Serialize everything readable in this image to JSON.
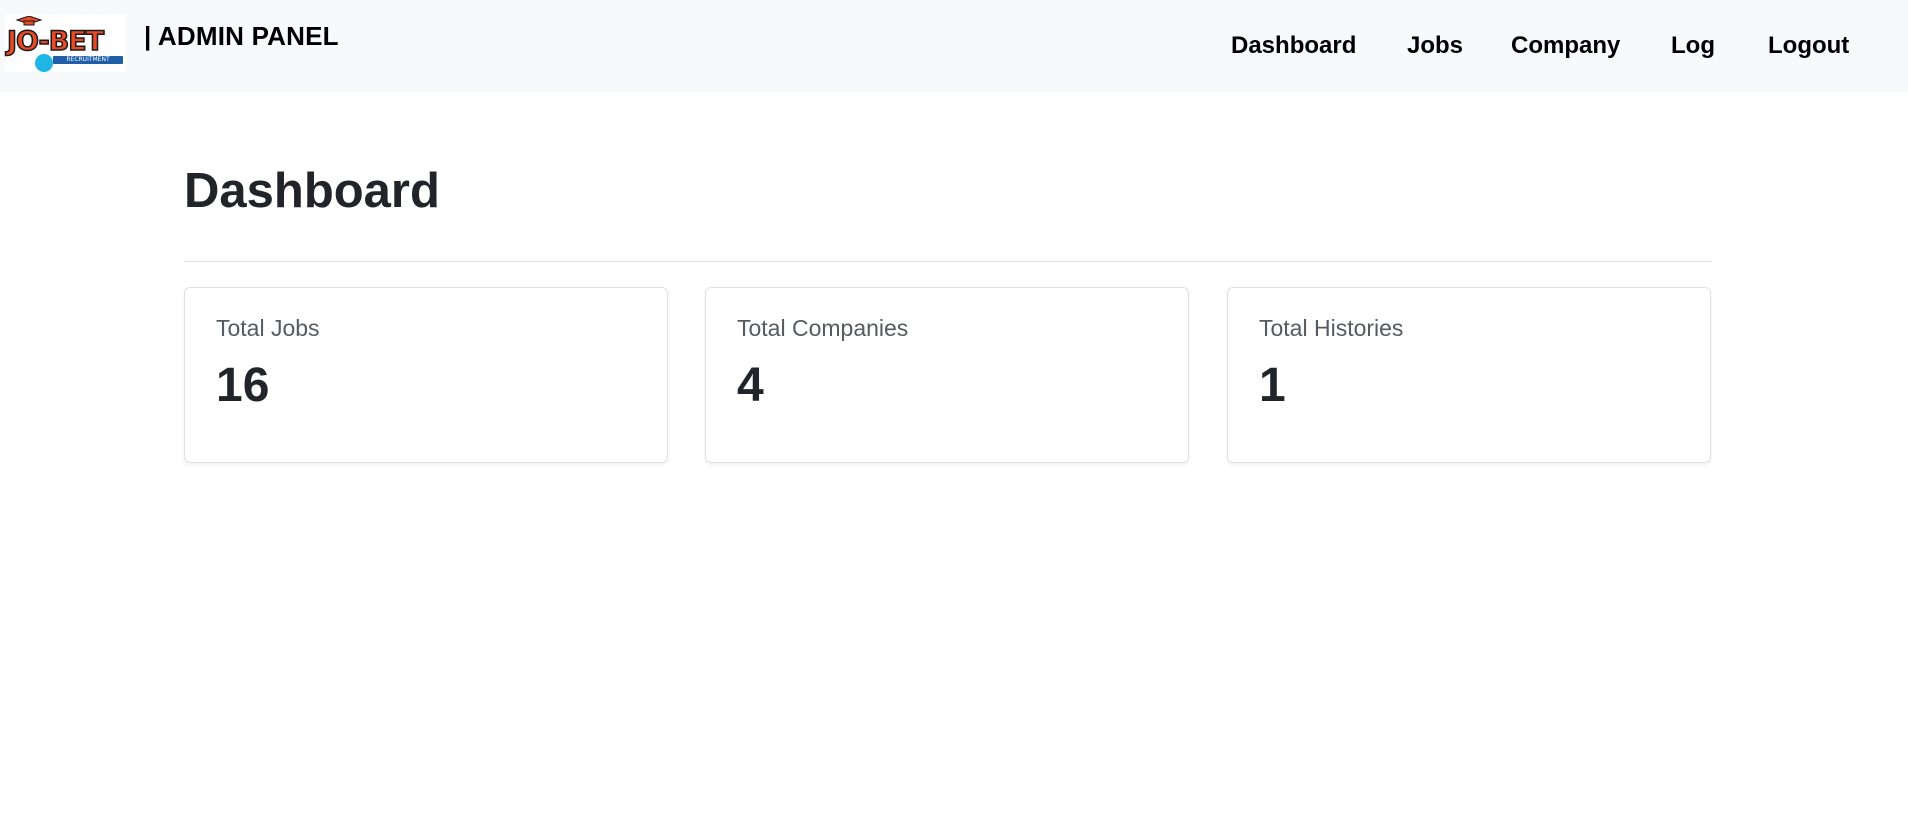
{
  "brand": {
    "logo_text": "JO-BET",
    "logo_tagline": "RECRUITMENT",
    "title": "| ADMIN PANEL"
  },
  "nav": {
    "items": [
      {
        "label": "Dashboard"
      },
      {
        "label": "Jobs"
      },
      {
        "label": "Company"
      },
      {
        "label": "Log"
      },
      {
        "label": "Logout"
      }
    ]
  },
  "page": {
    "title": "Dashboard"
  },
  "stats": [
    {
      "label": "Total Jobs",
      "value": "16"
    },
    {
      "label": "Total Companies",
      "value": "4"
    },
    {
      "label": "Total Histories",
      "value": "1"
    }
  ],
  "colors": {
    "navbar_bg": "#f8f9fa",
    "logo_orange": "#e84a26",
    "logo_blue": "#1fb6e6",
    "card_border": "#dee2e6"
  }
}
